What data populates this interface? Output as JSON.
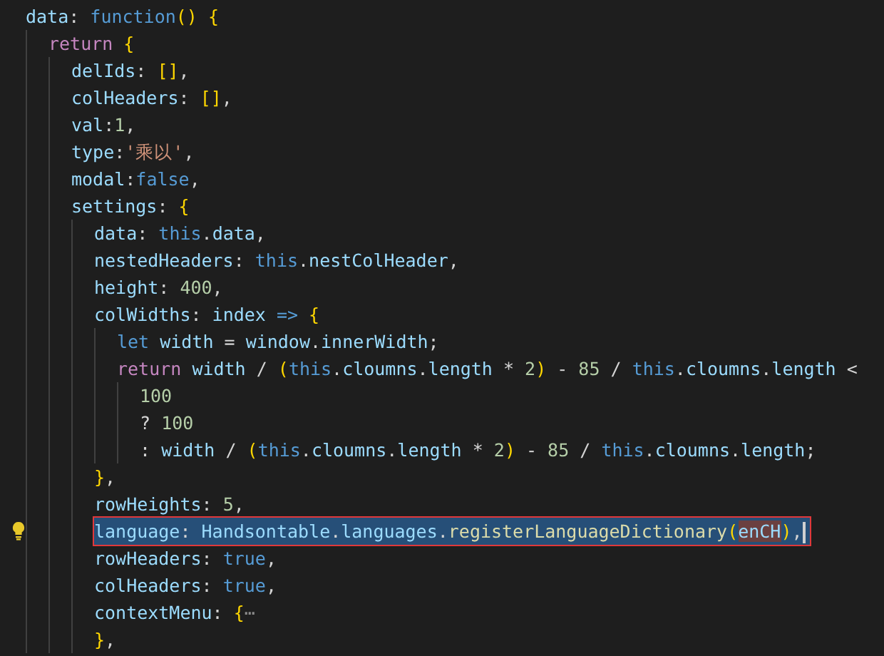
{
  "editor": {
    "lines": [
      {
        "selected": false,
        "lightbulb": false,
        "tokens": [
          {
            "text": "data",
            "kind": "property"
          },
          {
            "text": ": ",
            "kind": "plain"
          },
          {
            "text": "function",
            "kind": "keyword"
          },
          {
            "text": "() {",
            "kind": "bracket"
          }
        ],
        "children": [
          {
            "selected": false,
            "lightbulb": false,
            "tokens": [
              {
                "text": "return",
                "kind": "control"
              },
              {
                "text": " {",
                "kind": "bracket"
              }
            ],
            "children": [
              {
                "selected": false,
                "lightbulb": false,
                "tokens": [
                  {
                    "text": "delIds",
                    "kind": "property"
                  },
                  {
                    "text": ": ",
                    "kind": "plain"
                  },
                  {
                    "text": "[]",
                    "kind": "bracket"
                  },
                  {
                    "text": ",",
                    "kind": "plain"
                  }
                ]
              },
              {
                "selected": false,
                "lightbulb": false,
                "tokens": [
                  {
                    "text": "colHeaders",
                    "kind": "property"
                  },
                  {
                    "text": ": ",
                    "kind": "plain"
                  },
                  {
                    "text": "[]",
                    "kind": "bracket"
                  },
                  {
                    "text": ",",
                    "kind": "plain"
                  }
                ]
              },
              {
                "selected": false,
                "lightbulb": false,
                "tokens": [
                  {
                    "text": "val",
                    "kind": "property"
                  },
                  {
                    "text": ":",
                    "kind": "plain"
                  },
                  {
                    "text": "1",
                    "kind": "number"
                  },
                  {
                    "text": ",",
                    "kind": "plain"
                  }
                ]
              },
              {
                "selected": false,
                "lightbulb": false,
                "tokens": [
                  {
                    "text": "type",
                    "kind": "property"
                  },
                  {
                    "text": ":",
                    "kind": "plain"
                  },
                  {
                    "text": "'乘以'",
                    "kind": "string"
                  },
                  {
                    "text": ",",
                    "kind": "plain"
                  }
                ]
              },
              {
                "selected": false,
                "lightbulb": false,
                "tokens": [
                  {
                    "text": "modal",
                    "kind": "property"
                  },
                  {
                    "text": ":",
                    "kind": "plain"
                  },
                  {
                    "text": "false",
                    "kind": "keyword"
                  },
                  {
                    "text": ",",
                    "kind": "plain"
                  }
                ]
              },
              {
                "selected": false,
                "lightbulb": false,
                "tokens": [
                  {
                    "text": "settings",
                    "kind": "property"
                  },
                  {
                    "text": ": ",
                    "kind": "plain"
                  },
                  {
                    "text": "{",
                    "kind": "bracket"
                  }
                ],
                "children": [
                  {
                    "selected": false,
                    "lightbulb": false,
                    "tokens": [
                      {
                        "text": "data",
                        "kind": "property"
                      },
                      {
                        "text": ": ",
                        "kind": "plain"
                      },
                      {
                        "text": "this",
                        "kind": "keyword"
                      },
                      {
                        "text": ".",
                        "kind": "plain"
                      },
                      {
                        "text": "data",
                        "kind": "property"
                      },
                      {
                        "text": ",",
                        "kind": "plain"
                      }
                    ]
                  },
                  {
                    "selected": false,
                    "lightbulb": false,
                    "tokens": [
                      {
                        "text": "nestedHeaders",
                        "kind": "property"
                      },
                      {
                        "text": ": ",
                        "kind": "plain"
                      },
                      {
                        "text": "this",
                        "kind": "keyword"
                      },
                      {
                        "text": ".",
                        "kind": "plain"
                      },
                      {
                        "text": "nestColHeader",
                        "kind": "property"
                      },
                      {
                        "text": ",",
                        "kind": "plain"
                      }
                    ]
                  },
                  {
                    "selected": false,
                    "lightbulb": false,
                    "tokens": [
                      {
                        "text": "height",
                        "kind": "property"
                      },
                      {
                        "text": ": ",
                        "kind": "plain"
                      },
                      {
                        "text": "400",
                        "kind": "number"
                      },
                      {
                        "text": ",",
                        "kind": "plain"
                      }
                    ]
                  },
                  {
                    "selected": false,
                    "lightbulb": false,
                    "tokens": [
                      {
                        "text": "colWidths",
                        "kind": "property"
                      },
                      {
                        "text": ": ",
                        "kind": "plain"
                      },
                      {
                        "text": "index",
                        "kind": "property"
                      },
                      {
                        "text": " =>",
                        "kind": "keyword"
                      },
                      {
                        "text": " {",
                        "kind": "bracket"
                      }
                    ],
                    "children": [
                      {
                        "selected": false,
                        "lightbulb": false,
                        "tokens": [
                          {
                            "text": "let ",
                            "kind": "keyword"
                          },
                          {
                            "text": "width",
                            "kind": "property"
                          },
                          {
                            "text": " = ",
                            "kind": "plain"
                          },
                          {
                            "text": "window",
                            "kind": "property"
                          },
                          {
                            "text": ".",
                            "kind": "plain"
                          },
                          {
                            "text": "innerWidth",
                            "kind": "property"
                          },
                          {
                            "text": ";",
                            "kind": "plain"
                          }
                        ]
                      },
                      {
                        "selected": false,
                        "lightbulb": false,
                        "tokens": [
                          {
                            "text": "return ",
                            "kind": "control"
                          },
                          {
                            "text": "width",
                            "kind": "property"
                          },
                          {
                            "text": " / ",
                            "kind": "plain"
                          },
                          {
                            "text": "(",
                            "kind": "bracket"
                          },
                          {
                            "text": "this",
                            "kind": "keyword"
                          },
                          {
                            "text": ".",
                            "kind": "plain"
                          },
                          {
                            "text": "cloumns",
                            "kind": "property"
                          },
                          {
                            "text": ".",
                            "kind": "plain"
                          },
                          {
                            "text": "length",
                            "kind": "property"
                          },
                          {
                            "text": " * ",
                            "kind": "plain"
                          },
                          {
                            "text": "2",
                            "kind": "number"
                          },
                          {
                            "text": ")",
                            "kind": "bracket"
                          },
                          {
                            "text": " - ",
                            "kind": "plain"
                          },
                          {
                            "text": "85",
                            "kind": "number"
                          },
                          {
                            "text": " / ",
                            "kind": "plain"
                          },
                          {
                            "text": "this",
                            "kind": "keyword"
                          },
                          {
                            "text": ".",
                            "kind": "plain"
                          },
                          {
                            "text": "cloumns",
                            "kind": "property"
                          },
                          {
                            "text": ".",
                            "kind": "plain"
                          },
                          {
                            "text": "length",
                            "kind": "property"
                          },
                          {
                            "text": " <",
                            "kind": "plain"
                          }
                        ],
                        "children": [
                          {
                            "selected": false,
                            "lightbulb": false,
                            "tokens": [
                              {
                                "text": "100",
                                "kind": "number"
                              }
                            ]
                          },
                          {
                            "selected": false,
                            "lightbulb": false,
                            "tokens": [
                              {
                                "text": "? ",
                                "kind": "plain"
                              },
                              {
                                "text": "100",
                                "kind": "number"
                              }
                            ]
                          },
                          {
                            "selected": false,
                            "lightbulb": false,
                            "tokens": [
                              {
                                "text": ": ",
                                "kind": "plain"
                              },
                              {
                                "text": "width",
                                "kind": "property"
                              },
                              {
                                "text": " / ",
                                "kind": "plain"
                              },
                              {
                                "text": "(",
                                "kind": "bracket"
                              },
                              {
                                "text": "this",
                                "kind": "keyword"
                              },
                              {
                                "text": ".",
                                "kind": "plain"
                              },
                              {
                                "text": "cloumns",
                                "kind": "property"
                              },
                              {
                                "text": ".",
                                "kind": "plain"
                              },
                              {
                                "text": "length",
                                "kind": "property"
                              },
                              {
                                "text": " * ",
                                "kind": "plain"
                              },
                              {
                                "text": "2",
                                "kind": "number"
                              },
                              {
                                "text": ")",
                                "kind": "bracket"
                              },
                              {
                                "text": " - ",
                                "kind": "plain"
                              },
                              {
                                "text": "85",
                                "kind": "number"
                              },
                              {
                                "text": " / ",
                                "kind": "plain"
                              },
                              {
                                "text": "this",
                                "kind": "keyword"
                              },
                              {
                                "text": ".",
                                "kind": "plain"
                              },
                              {
                                "text": "cloumns",
                                "kind": "property"
                              },
                              {
                                "text": ".",
                                "kind": "plain"
                              },
                              {
                                "text": "length",
                                "kind": "property"
                              },
                              {
                                "text": ";",
                                "kind": "plain"
                              }
                            ]
                          }
                        ]
                      }
                    ]
                  },
                  {
                    "selected": false,
                    "lightbulb": false,
                    "tokens": [
                      {
                        "text": "}",
                        "kind": "bracket"
                      },
                      {
                        "text": ",",
                        "kind": "plain"
                      }
                    ]
                  },
                  {
                    "selected": false,
                    "lightbulb": false,
                    "tokens": [
                      {
                        "text": "rowHeights",
                        "kind": "property"
                      },
                      {
                        "text": ": ",
                        "kind": "plain"
                      },
                      {
                        "text": "5",
                        "kind": "number"
                      },
                      {
                        "text": ",",
                        "kind": "plain"
                      }
                    ]
                  },
                  {
                    "selected": true,
                    "lightbulb": true,
                    "tokens": [
                      {
                        "text": "language",
                        "kind": "property"
                      },
                      {
                        "text": ": ",
                        "kind": "plain"
                      },
                      {
                        "text": "Handsontable",
                        "kind": "property"
                      },
                      {
                        "text": ".",
                        "kind": "plain"
                      },
                      {
                        "text": "languages",
                        "kind": "property"
                      },
                      {
                        "text": ".",
                        "kind": "plain"
                      },
                      {
                        "text": "registerLanguageDictionary",
                        "kind": "function"
                      },
                      {
                        "text": "(",
                        "kind": "bracket"
                      },
                      {
                        "text": "enCH",
                        "kind": "match"
                      },
                      {
                        "text": ")",
                        "kind": "bracket"
                      },
                      {
                        "text": ",",
                        "kind": "plain"
                      }
                    ]
                  },
                  {
                    "selected": false,
                    "lightbulb": false,
                    "tokens": [
                      {
                        "text": "rowHeaders",
                        "kind": "property"
                      },
                      {
                        "text": ": ",
                        "kind": "plain"
                      },
                      {
                        "text": "true",
                        "kind": "keyword"
                      },
                      {
                        "text": ",",
                        "kind": "plain"
                      }
                    ]
                  },
                  {
                    "selected": false,
                    "lightbulb": false,
                    "tokens": [
                      {
                        "text": "colHeaders",
                        "kind": "property"
                      },
                      {
                        "text": ": ",
                        "kind": "plain"
                      },
                      {
                        "text": "true",
                        "kind": "keyword"
                      },
                      {
                        "text": ",",
                        "kind": "plain"
                      }
                    ]
                  },
                  {
                    "selected": false,
                    "lightbulb": false,
                    "tokens": [
                      {
                        "text": "contextMenu",
                        "kind": "property"
                      },
                      {
                        "text": ": ",
                        "kind": "plain"
                      },
                      {
                        "text": "{",
                        "kind": "bracket"
                      },
                      {
                        "text": "⋯",
                        "kind": "fold"
                      }
                    ]
                  },
                  {
                    "selected": false,
                    "lightbulb": false,
                    "tokens": [
                      {
                        "text": "}",
                        "kind": "bracket"
                      },
                      {
                        "text": ",",
                        "kind": "plain"
                      }
                    ]
                  }
                ]
              }
            ]
          }
        ]
      }
    ]
  }
}
